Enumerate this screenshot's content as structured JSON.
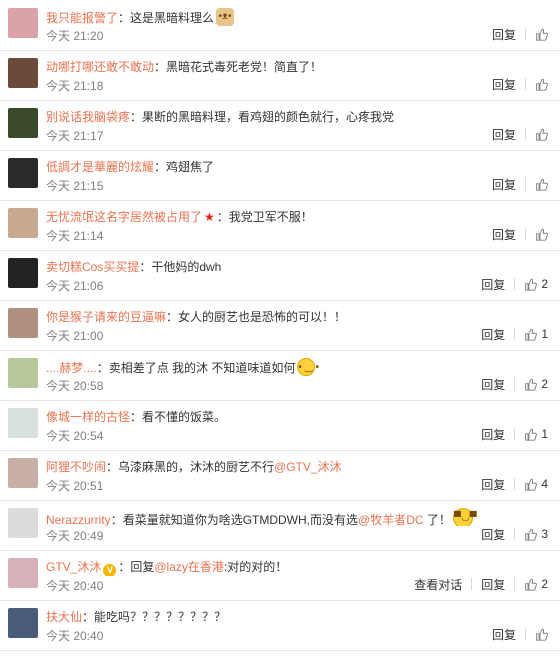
{
  "comments": [
    {
      "user": "我只能报警了",
      "text": "：这是黑暗料理么",
      "emoji": "doge-icon",
      "time": "今天 21:20",
      "reply": "回复",
      "likes": ""
    },
    {
      "user": "动哪打哪还敢不敢动",
      "text": "：黑暗花式毒死老党！简直了！",
      "time": "今天 21:18",
      "reply": "回复",
      "likes": ""
    },
    {
      "user": "别说话我脑袋疼",
      "text": "：果断的黑暗料理，看鸡翅的颜色就行，心疼我党",
      "time": "今天 21:17",
      "reply": "回复",
      "likes": ""
    },
    {
      "user": "低調才是華麗的炫耀",
      "text": "：鸡翅焦了",
      "time": "今天 21:15",
      "reply": "回复",
      "likes": ""
    },
    {
      "user": "无忧流氓这名字居然被占用了",
      "badge": "star",
      "text": "：我党卫军不服！",
      "time": "今天 21:14",
      "reply": "回复",
      "likes": ""
    },
    {
      "user": "卖切糕Cos买买提",
      "text": "：干他妈的dwh",
      "time": "今天 21:06",
      "reply": "回复",
      "likes": "2"
    },
    {
      "user": "你是猴子请来的豆逼嘛",
      "text": "：女人的厨艺也是恐怖的可以！！",
      "time": "今天 21:00",
      "reply": "回复",
      "likes": "1"
    },
    {
      "user": "....赫梦....",
      "text": "：卖相差了点 我的沐 不知道味道如何",
      "emoji": "smile-icon",
      "time": "今天 20:58",
      "reply": "回复",
      "likes": "2"
    },
    {
      "user": "像城一样的古怪",
      "text": "：看不懂的饭菜。",
      "time": "今天 20:54",
      "reply": "回复",
      "likes": "1"
    },
    {
      "user": "阿狸不吵闹",
      "text": "：乌漆麻黑的，沐沐的厨艺不行",
      "mention": "@GTV_沐沐",
      "time": "今天 20:51",
      "reply": "回复",
      "likes": "4"
    },
    {
      "user": "Nerazzurrity",
      "text": "：看菜量就知道你为啥选GTMDDWH,而没有选",
      "mention": "@牧羊者DC",
      "tail": " 了！",
      "emoji": "grin-icon",
      "time": "今天 20:49",
      "reply": "回复",
      "likes": "3"
    },
    {
      "user": "GTV_沐沐",
      "badge": "v",
      "text": "：回复",
      "mention": "@lazy在香港",
      "tail": ":对的对的！",
      "time": "今天 20:40",
      "view": "查看对话",
      "reply": "回复",
      "likes": "2"
    },
    {
      "user": "扶大仙",
      "text": "：能吃吗？？？？？？？？",
      "time": "今天 20:40",
      "reply": "回复",
      "likes": ""
    }
  ],
  "avatar_colors": [
    "#d9a3a8",
    "#6b4a3a",
    "#3a4a2a",
    "#2a2a2a",
    "#c8a890",
    "#222222",
    "#b09080",
    "#b8c89a",
    "#d8e0e0",
    "#c8b0a8",
    "#dcdcdc",
    "#d8b0b8",
    "#4a5a7a"
  ]
}
